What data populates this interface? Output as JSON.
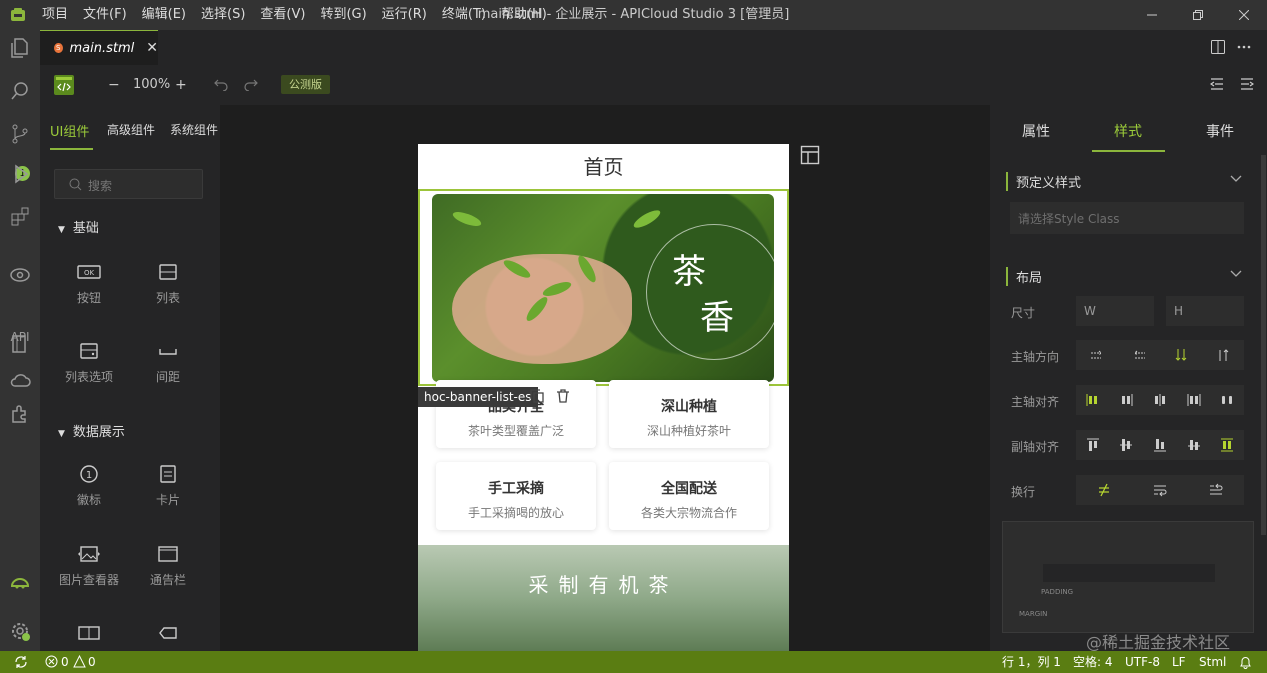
{
  "window": {
    "title": "main.stml - 企业展示 - APICloud Studio 3 [管理员]",
    "menu": [
      "项目",
      "文件(F)",
      "编辑(E)",
      "选择(S)",
      "查看(V)",
      "转到(G)",
      "运行(R)",
      "终端(T)",
      "帮助(H)"
    ]
  },
  "activity": {
    "scm_badge": "1",
    "api_label": "API"
  },
  "tabs": [
    {
      "label": "main.stml",
      "file_icon_text": "S"
    }
  ],
  "toolbar": {
    "zoom": "100%",
    "minus": "−",
    "plus": "+",
    "beta_label": "公测版"
  },
  "left_panel": {
    "tabs": [
      "UI组件",
      "高级组件",
      "系统组件"
    ],
    "search_placeholder": "搜索",
    "sections": [
      {
        "title": "基础",
        "items": [
          "按钮",
          "列表",
          "列表选项",
          "间距"
        ]
      },
      {
        "title": "数据展示",
        "items": [
          "徽标",
          "卡片",
          "图片查看器",
          "通告栏"
        ]
      }
    ]
  },
  "canvas": {
    "page_title": "首页",
    "banner_text": [
      "茶",
      "香"
    ],
    "selected_component": "hoc-banner-list-es",
    "cards": [
      {
        "title": "品类齐全",
        "subtitle": "茶叶类型覆盖广泛"
      },
      {
        "title": "深山种植",
        "subtitle": "深山种植好茶叶"
      },
      {
        "title": "手工采摘",
        "subtitle": "手工采摘喝的放心"
      },
      {
        "title": "全国配送",
        "subtitle": "各类大宗物流合作"
      }
    ],
    "section_title": "采制有机茶"
  },
  "right_panel": {
    "tabs": [
      "属性",
      "样式",
      "事件"
    ],
    "predefined_title": "预定义样式",
    "style_class_placeholder": "请选择Style Class",
    "layout_title": "布局",
    "labels": {
      "size": "尺寸",
      "direction": "主轴方向",
      "main_align": "主轴对齐",
      "cross_align": "副轴对齐",
      "wrap": "换行"
    },
    "width_placeholder": "W",
    "height_placeholder": "H",
    "padding_label": "PADDING",
    "margin_label": "MARGIN"
  },
  "statusbar": {
    "errors": "0",
    "warnings": "0",
    "position": "行 1，列 1",
    "spaces": "空格: 4",
    "encoding": "UTF-8",
    "eol": "LF",
    "language": "Stml"
  },
  "watermark": "@稀土掘金技术社区",
  "colors": {
    "accent": "#8cb63c",
    "status_bar": "#5a7d12",
    "badge": "#8bc34a"
  }
}
